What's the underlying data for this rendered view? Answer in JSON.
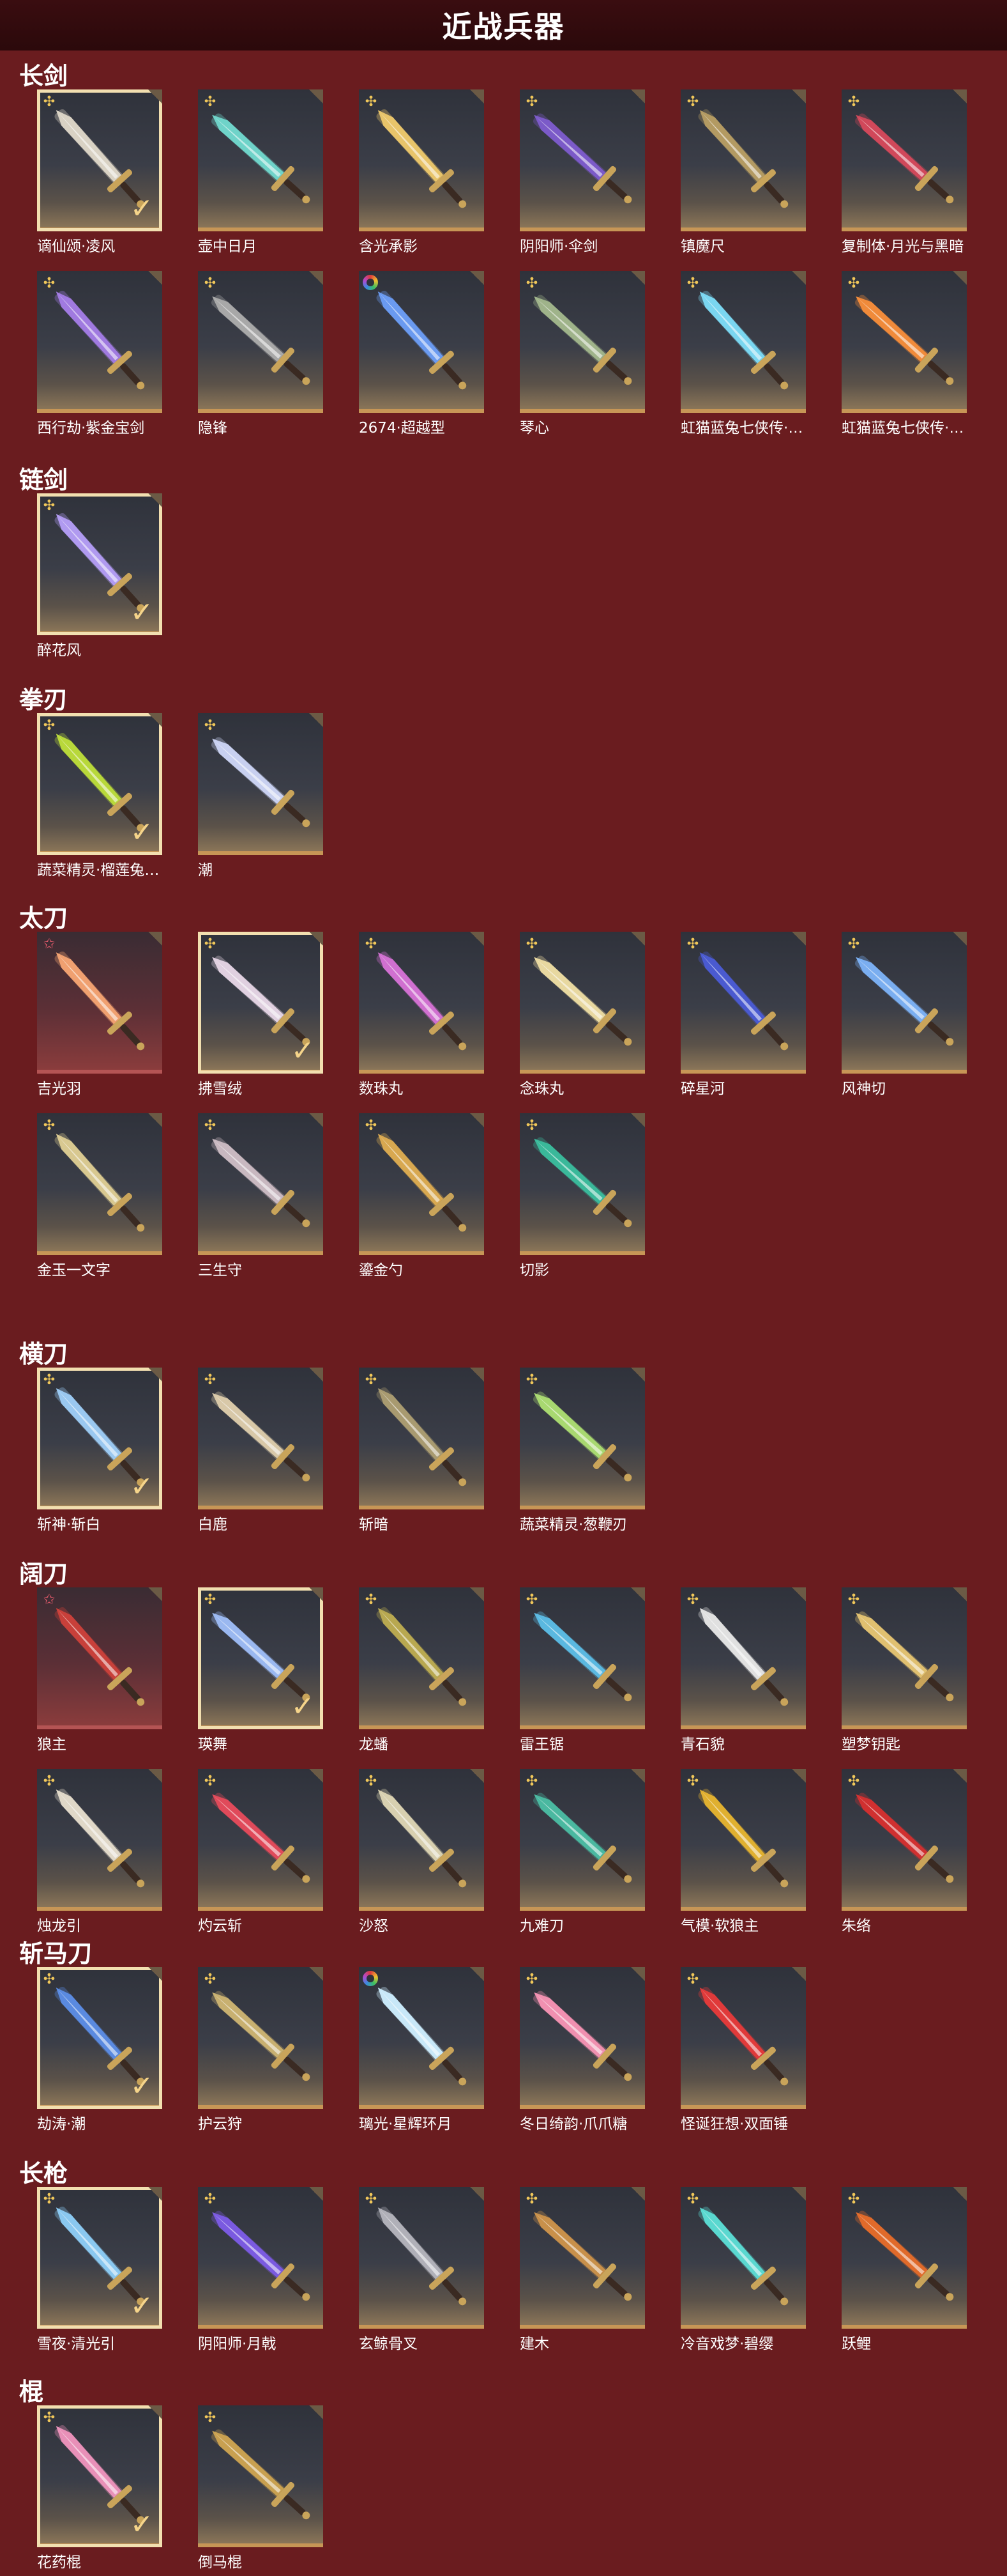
{
  "page": {
    "title": "近战兵器"
  },
  "categories": [
    {
      "name": "长剑",
      "items": [
        {
          "name": "谪仙颂·凌风",
          "badge": "flower",
          "owned": true,
          "color": "#d9d2c4"
        },
        {
          "name": "壶中日月",
          "badge": "flower",
          "owned": false,
          "color": "#6fd3c9"
        },
        {
          "name": "含光承影",
          "badge": "flower",
          "owned": false,
          "color": "#e8c46a"
        },
        {
          "name": "阴阳师·伞剑",
          "badge": "flower",
          "owned": false,
          "color": "#7b5ac8"
        },
        {
          "name": "镇魔尺",
          "badge": "flower",
          "owned": false,
          "color": "#b39a62"
        },
        {
          "name": "复制体·月光与黑暗",
          "badge": "flower",
          "owned": false,
          "color": "#d0485a"
        },
        {
          "name": "西行劫·紫金宝剑",
          "badge": "flower",
          "owned": false,
          "color": "#a07ae0"
        },
        {
          "name": "隐锋",
          "badge": "flower",
          "owned": false,
          "color": "#a8a8a8"
        },
        {
          "name": "2674·超越型",
          "badge": "ring",
          "owned": false,
          "color": "#6a9af0"
        },
        {
          "name": "琴心",
          "badge": "flower",
          "owned": false,
          "color": "#9fb38a"
        },
        {
          "name": "虹猫蓝兔七侠传·冰魄剑",
          "badge": "flower",
          "owned": false,
          "color": "#7ad6f0"
        },
        {
          "name": "虹猫蓝兔七侠传·长虹剑",
          "badge": "flower",
          "owned": false,
          "color": "#f08a3a"
        }
      ]
    },
    {
      "name": "链剑",
      "items": [
        {
          "name": "醉花风",
          "badge": "flower",
          "owned": true,
          "color": "#b09af0"
        }
      ]
    },
    {
      "name": "拳刃",
      "items": [
        {
          "name": "蔬菜精灵·榴莲兔兔拳",
          "badge": "flower",
          "owned": true,
          "color": "#b8d83a"
        },
        {
          "name": "潮",
          "badge": "flower",
          "owned": false,
          "color": "#c8d0f0"
        }
      ]
    },
    {
      "name": "太刀",
      "items": [
        {
          "name": "吉光羽",
          "badge": "star",
          "owned": false,
          "rare": true,
          "color": "#f0a070"
        },
        {
          "name": "拂雪绒",
          "badge": "flower",
          "owned": true,
          "color": "#e0d0e0"
        },
        {
          "name": "数珠丸",
          "badge": "flower",
          "owned": false,
          "color": "#d070d0"
        },
        {
          "name": "念珠丸",
          "badge": "flower",
          "owned": false,
          "color": "#e8d8a0"
        },
        {
          "name": "碎星河",
          "badge": "flower",
          "owned": false,
          "color": "#4a5ad0"
        },
        {
          "name": "风神切",
          "badge": "flower",
          "owned": false,
          "color": "#7aaef0"
        },
        {
          "name": "金玉一文字",
          "badge": "flower",
          "owned": false,
          "color": "#d8c890"
        },
        {
          "name": "三生守",
          "badge": "flower",
          "owned": false,
          "color": "#c8b8c0"
        },
        {
          "name": "鎏金勺",
          "badge": "flower",
          "owned": false,
          "color": "#d8a850"
        },
        {
          "name": "切影",
          "badge": "flower",
          "owned": false,
          "color": "#3ab89a"
        }
      ]
    },
    {
      "name": "横刀",
      "items": [
        {
          "name": "斩神·斩白",
          "badge": "flower",
          "owned": true,
          "color": "#9ac8f0"
        },
        {
          "name": "白鹿",
          "badge": "flower",
          "owned": false,
          "color": "#d8c8a8"
        },
        {
          "name": "斩暗",
          "badge": "flower",
          "owned": false,
          "color": "#a89a70"
        },
        {
          "name": "蔬菜精灵·葱鞭刃",
          "badge": "flower",
          "owned": false,
          "color": "#a8d870"
        }
      ]
    },
    {
      "name": "阔刀",
      "items": [
        {
          "name": "狼主",
          "badge": "star",
          "owned": false,
          "rare": true,
          "color": "#c8403a"
        },
        {
          "name": "瑛舞",
          "badge": "flower",
          "owned": true,
          "color": "#9ab8f0"
        },
        {
          "name": "龙蟠",
          "badge": "flower",
          "owned": false,
          "color": "#b8a850"
        },
        {
          "name": "雷王锯",
          "badge": "flower",
          "owned": false,
          "color": "#5ab8e0"
        },
        {
          "name": "青石貌",
          "badge": "flower",
          "owned": false,
          "color": "#e0e0e0"
        },
        {
          "name": "塑梦钥匙",
          "badge": "flower",
          "owned": false,
          "color": "#e0c070"
        },
        {
          "name": "烛龙引",
          "badge": "flower",
          "owned": false,
          "color": "#e0d8c8"
        },
        {
          "name": "灼云斩",
          "badge": "flower",
          "owned": false,
          "color": "#e04a5a"
        },
        {
          "name": "沙怒",
          "badge": "flower",
          "owned": false,
          "color": "#d8d0b0"
        },
        {
          "name": "九难刀",
          "badge": "flower",
          "owned": false,
          "color": "#4ab8a0"
        },
        {
          "name": "气模·软狼主",
          "badge": "flower",
          "owned": false,
          "color": "#e0b030"
        },
        {
          "name": "朱络",
          "badge": "flower",
          "owned": false,
          "color": "#d03030"
        }
      ]
    },
    {
      "name": "斩马刀",
      "items": [
        {
          "name": "劫涛·潮",
          "badge": "flower",
          "owned": true,
          "color": "#5a8ae0"
        },
        {
          "name": "护云狩",
          "badge": "flower",
          "owned": false,
          "color": "#c8b070"
        },
        {
          "name": "璃光·星辉环月",
          "badge": "ring",
          "owned": false,
          "color": "#c8e8f8"
        },
        {
          "name": "冬日绮韵·爪爪糖",
          "badge": "flower",
          "owned": false,
          "color": "#f090b0"
        },
        {
          "name": "怪诞狂想·双面锤",
          "badge": "flower",
          "owned": false,
          "color": "#e03a3a"
        }
      ]
    },
    {
      "name": "长枪",
      "items": [
        {
          "name": "雪夜·清光引",
          "badge": "flower",
          "owned": true,
          "color": "#8ac8f0"
        },
        {
          "name": "阴阳师·月戟",
          "badge": "flower",
          "owned": false,
          "color": "#7a5ae0"
        },
        {
          "name": "玄鲸骨叉",
          "badge": "flower",
          "owned": false,
          "color": "#b0b0b8"
        },
        {
          "name": "建木",
          "badge": "flower",
          "owned": false,
          "color": "#c8904a"
        },
        {
          "name": "冷音戏梦·碧缨",
          "badge": "flower",
          "owned": false,
          "color": "#5ad8d0"
        },
        {
          "name": "跃鲤",
          "badge": "flower",
          "owned": false,
          "color": "#e06a2a"
        }
      ]
    },
    {
      "name": "棍",
      "items": [
        {
          "name": "花药棍",
          "badge": "flower",
          "owned": true,
          "color": "#e890b8"
        },
        {
          "name": "倒马棍",
          "badge": "flower",
          "owned": false,
          "color": "#c8a050"
        }
      ]
    }
  ]
}
